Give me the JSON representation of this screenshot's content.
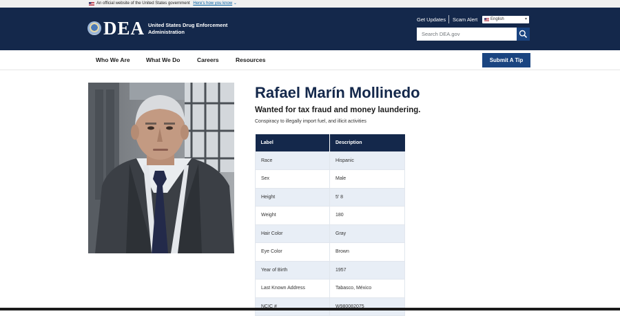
{
  "gov_banner": {
    "text": "An official website of the United States government",
    "link": "Here's how you know"
  },
  "header": {
    "logo_text": "DEA",
    "agency_name": "United States Drug Enforcement Administration",
    "get_updates": "Get Updates",
    "scam_alert": "Scam Alert",
    "language": "English",
    "search_placeholder": "Search DEA.gov",
    "colors": {
      "header_bg": "#14284b",
      "accent": "#1a4480"
    }
  },
  "nav": {
    "items": [
      "Who We Are",
      "What We Do",
      "Careers",
      "Resources"
    ],
    "submit_tip": "Submit A Tip"
  },
  "fugitive": {
    "name": "Rafael Marín Mollinedo",
    "wanted_for": "Wanted for tax fraud and money laundering.",
    "charges": "Conspiracy to illegally import fuel, and illicit activities",
    "table": {
      "headers": [
        "Label",
        "Description"
      ],
      "rows": [
        [
          "Race",
          "Hispanic"
        ],
        [
          "Sex",
          "Male"
        ],
        [
          "Height",
          "5' 8"
        ],
        [
          "Weight",
          "180"
        ],
        [
          "Hair Color",
          "Gray"
        ],
        [
          "Eye Color",
          "Brown"
        ],
        [
          "Year of Birth",
          "1957"
        ],
        [
          "Last Known Address",
          "Tabasco, México"
        ],
        [
          "NCIC #",
          "W980082075"
        ]
      ]
    }
  }
}
